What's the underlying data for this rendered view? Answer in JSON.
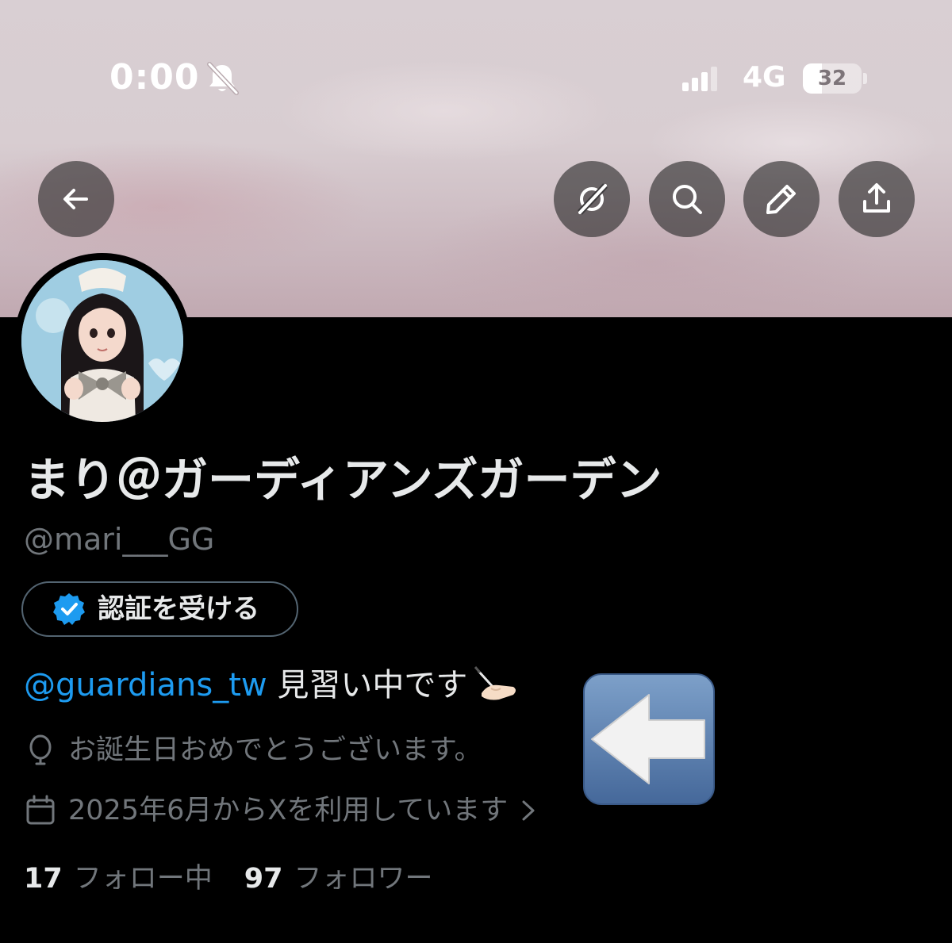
{
  "status_bar": {
    "time": "0:00",
    "network": "4G",
    "battery_level": "32",
    "battery_fraction": 0.32,
    "silent_icon": "bell-slash-icon",
    "signal_icon": "cellular-signal-icon"
  },
  "toolbar": {
    "back_icon": "arrow-left-icon",
    "grok_icon": "grok-icon",
    "search_icon": "search-icon",
    "edit_icon": "pencil-icon",
    "share_icon": "share-icon"
  },
  "profile": {
    "display_name": "まり＠ガーディアンズガーデン",
    "handle": "@mari___GG",
    "verify_button_label": "認証を受ける",
    "bio_mention": "@guardians_tw",
    "bio_text": " 見習い中です",
    "location": "お誕生日おめでとうございます。",
    "joined": "2025年6月からXを利用しています",
    "following_count": "17",
    "following_label": "フォロー中",
    "followers_count": "97",
    "followers_label": "フォロワー"
  },
  "colors": {
    "background": "#000000",
    "text_primary": "#e7e9ea",
    "text_secondary": "#71767b",
    "link": "#1d9bf0",
    "verified_badge": "#1d9bf0"
  }
}
